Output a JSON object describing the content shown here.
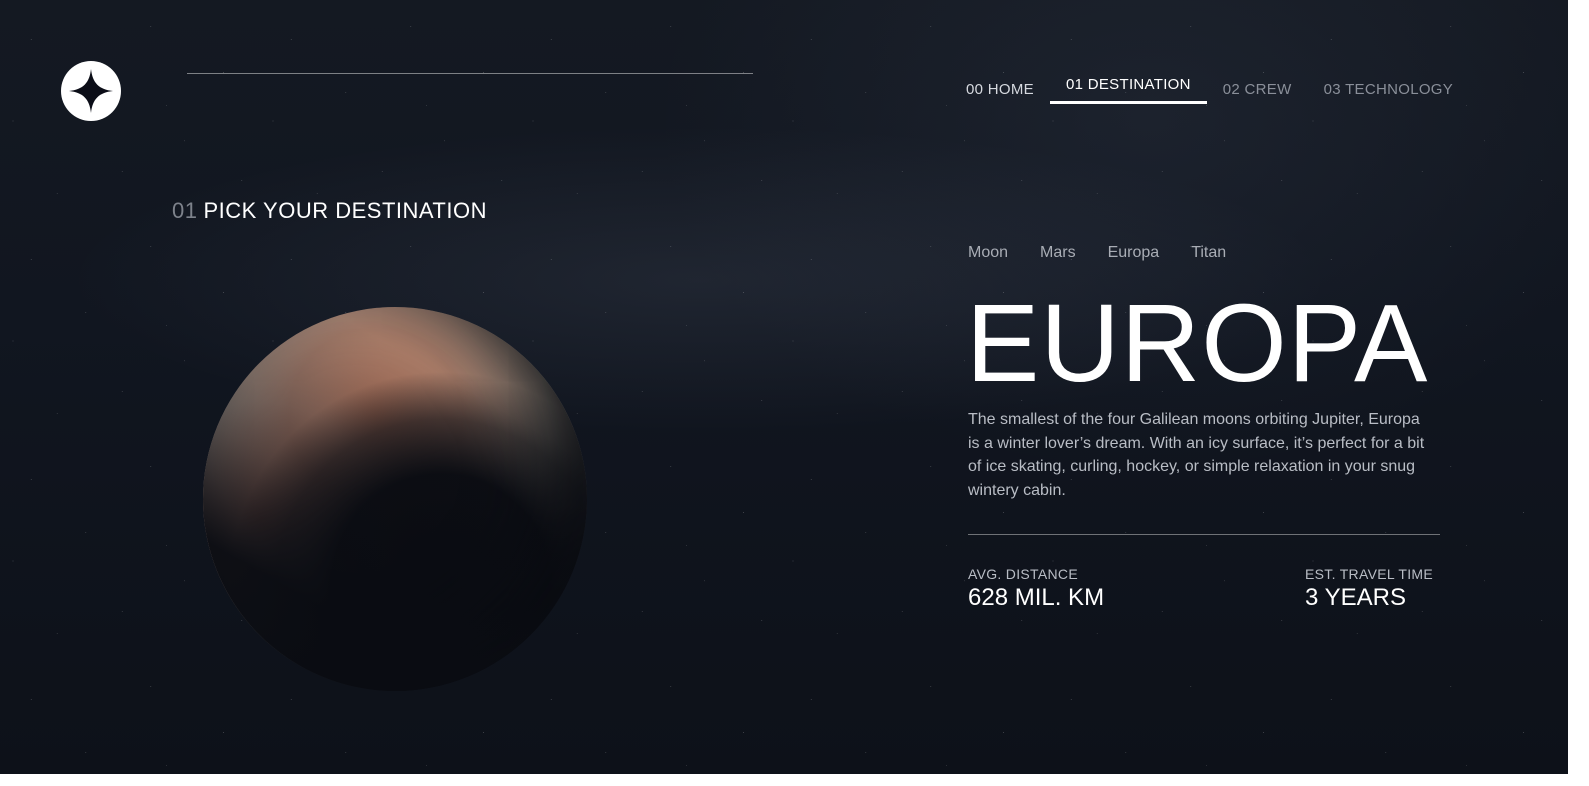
{
  "nav": {
    "items": [
      {
        "num": "00",
        "label": "HOME"
      },
      {
        "num": "01",
        "label": "DESTINATION"
      },
      {
        "num": "02",
        "label": "CREW"
      },
      {
        "num": "03",
        "label": "TECHNOLOGY"
      }
    ],
    "active_index": 1
  },
  "section": {
    "num": "01",
    "title": "PICK YOUR DESTINATION"
  },
  "tabs": [
    "Moon",
    "Mars",
    "Europa",
    "Titan"
  ],
  "destination": {
    "name": "EUROPA",
    "description": "The smallest of the four Galilean moons orbiting Jupiter, Europa is a winter lover’s dream. With an icy surface, it’s perfect for a bit of ice skating, curling, hockey, or simple relaxation in your snug wintery cabin.",
    "distance_label": "AVG. DISTANCE",
    "distance_value": "628 MIL. KM",
    "travel_label": "EST. TRAVEL TIME",
    "travel_value": "3 YEARS"
  },
  "icons": {
    "logo": "star-logo-icon"
  },
  "colors": {
    "background": "#111620",
    "text": "#ffffff",
    "muted": "#b9bdc5"
  }
}
